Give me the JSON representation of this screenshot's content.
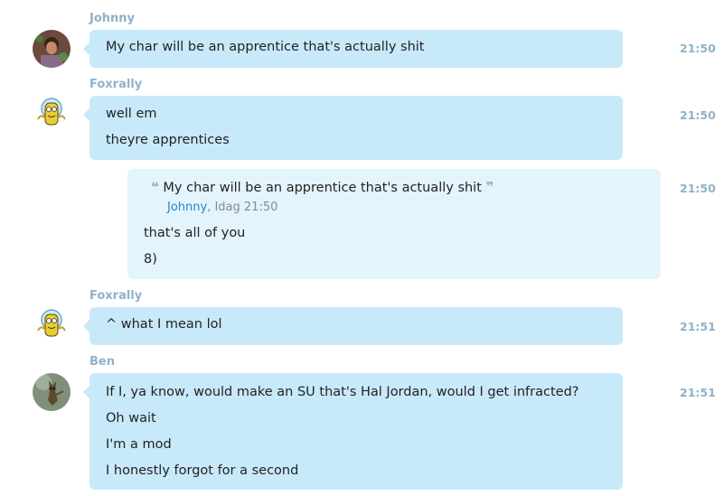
{
  "messages": [
    {
      "sender": "Johnny",
      "avatar_icon": "johnny-avatar",
      "lines": [
        "My char will be an apprentice that's actually shit"
      ],
      "time": "21:50"
    },
    {
      "sender": "Foxrally",
      "avatar_icon": "foxrally-avatar",
      "lines": [
        "well em",
        "theyre apprentices"
      ],
      "time": "21:50"
    },
    {
      "quote": {
        "text": "My char will be an apprentice that's actually shit",
        "author": "Johnny",
        "date": ", Idag 21:50"
      },
      "lines": [
        "that's all of you",
        "8)"
      ],
      "time": "21:50"
    },
    {
      "sender": "Foxrally",
      "avatar_icon": "foxrally-avatar",
      "lines": [
        "^ what I mean lol"
      ],
      "time": "21:51"
    },
    {
      "sender": "Ben",
      "avatar_icon": "ben-avatar",
      "lines": [
        "If I, ya know, would make an SU that's Hal Jordan, would I get infracted?",
        "Oh wait",
        "I'm a mod",
        "I honestly forgot for a second"
      ],
      "time": "21:51"
    }
  ],
  "colors": {
    "bubble": "#c8e9fa",
    "quote_bubble": "#e3f4fc",
    "sender": "#8fb2c8",
    "quote_author": "#2a86c5"
  }
}
